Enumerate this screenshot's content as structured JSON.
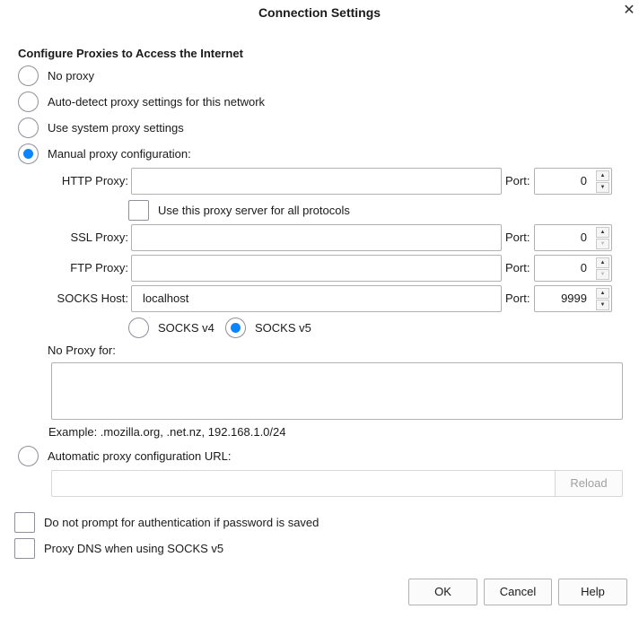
{
  "window": {
    "title": "Connection Settings",
    "close_glyph": "✕"
  },
  "section_title": "Configure Proxies to Access the Internet",
  "proxy_modes": [
    {
      "label": "No proxy",
      "checked": false
    },
    {
      "label": "Auto-detect proxy settings for this network",
      "checked": false
    },
    {
      "label": "Use system proxy settings",
      "checked": false
    },
    {
      "label": "Manual proxy configuration:",
      "checked": true
    }
  ],
  "manual": {
    "http": {
      "label": "HTTP Proxy:",
      "value": "",
      "port_label": "Port:",
      "port": "0"
    },
    "use_for_all_label": "Use this proxy server for all protocols",
    "use_for_all_checked": false,
    "ssl": {
      "label": "SSL Proxy:",
      "value": "",
      "port_label": "Port:",
      "port": "0"
    },
    "ftp": {
      "label": "FTP Proxy:",
      "value": "",
      "port_label": "Port:",
      "port": "0"
    },
    "socks": {
      "label": "SOCKS Host:",
      "value": "localhost",
      "port_label": "Port:",
      "port": "9999"
    },
    "socks_v4_label": "SOCKS v4",
    "socks_v5_label": "SOCKS v5",
    "socks_version": "v5"
  },
  "no_proxy_for": {
    "label": "No Proxy for:",
    "value": "",
    "example": "Example: .mozilla.org, .net.nz, 192.168.1.0/24"
  },
  "auto_config": {
    "label": "Automatic proxy configuration URL:",
    "checked": false,
    "value": "",
    "reload_label": "Reload"
  },
  "options": {
    "no_prompt_auth_label": "Do not prompt for authentication if password is saved",
    "proxy_dns_label": "Proxy DNS when using SOCKS v5"
  },
  "buttons": {
    "ok": "OK",
    "cancel": "Cancel",
    "help": "Help"
  },
  "colors": {
    "accent": "#0a84ff",
    "border": "#b1b1b3",
    "disabled_text": "#a0a0a0"
  },
  "icons": {
    "close": "close-icon",
    "spin_up": "chevron-up-icon",
    "spin_down": "chevron-down-icon"
  }
}
